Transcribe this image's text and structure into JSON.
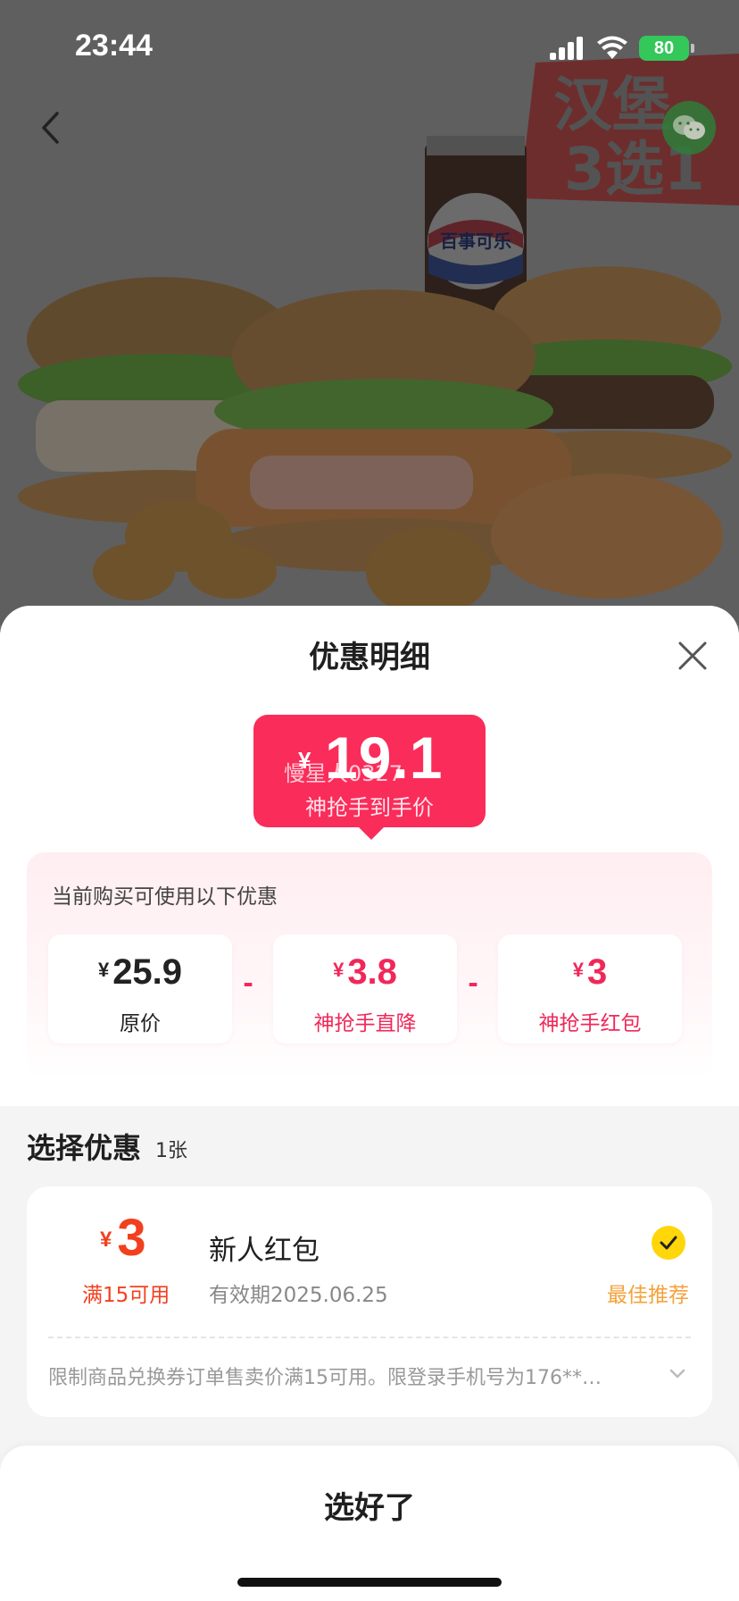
{
  "status_bar": {
    "time": "23:44",
    "battery": "80"
  },
  "hero": {
    "back_icon": "chevron-left-icon",
    "brand_text": "百事可乐",
    "promo_badge_line1": "汉堡",
    "promo_badge_line2": "3选1",
    "share_icon": "wechat-icon"
  },
  "sheet": {
    "title": "优惠明细",
    "close_icon": "close-icon",
    "final_price": {
      "currency": "¥",
      "value": "19.1",
      "watermark": "慢星人0327",
      "label": "神抢手到手价"
    },
    "breakdown": {
      "heading": "当前购买可使用以下优惠",
      "items": [
        {
          "currency": "¥",
          "value": "25.9",
          "label": "原价"
        },
        {
          "currency": "¥",
          "value": "3.8",
          "label": "神抢手直降"
        },
        {
          "currency": "¥",
          "value": "3",
          "label": "神抢手红包"
        }
      ],
      "operator": "-"
    },
    "choose": {
      "title": "选择优惠",
      "count": "1张"
    },
    "coupon": {
      "currency": "¥",
      "amount": "3",
      "condition": "满15可用",
      "name": "新人红包",
      "expiry": "有效期2025.06.25",
      "recommend": "最佳推荐",
      "terms": "限制商品兑换券订单售卖价满15可用。限登录手机号为176**…",
      "selected": true
    },
    "confirm_label": "选好了"
  },
  "colors": {
    "accent_pink": "#fa2c5a",
    "coupon_orange": "#f2401f",
    "recommend_orange": "#f5a23a",
    "check_yellow": "#ffd60a"
  }
}
